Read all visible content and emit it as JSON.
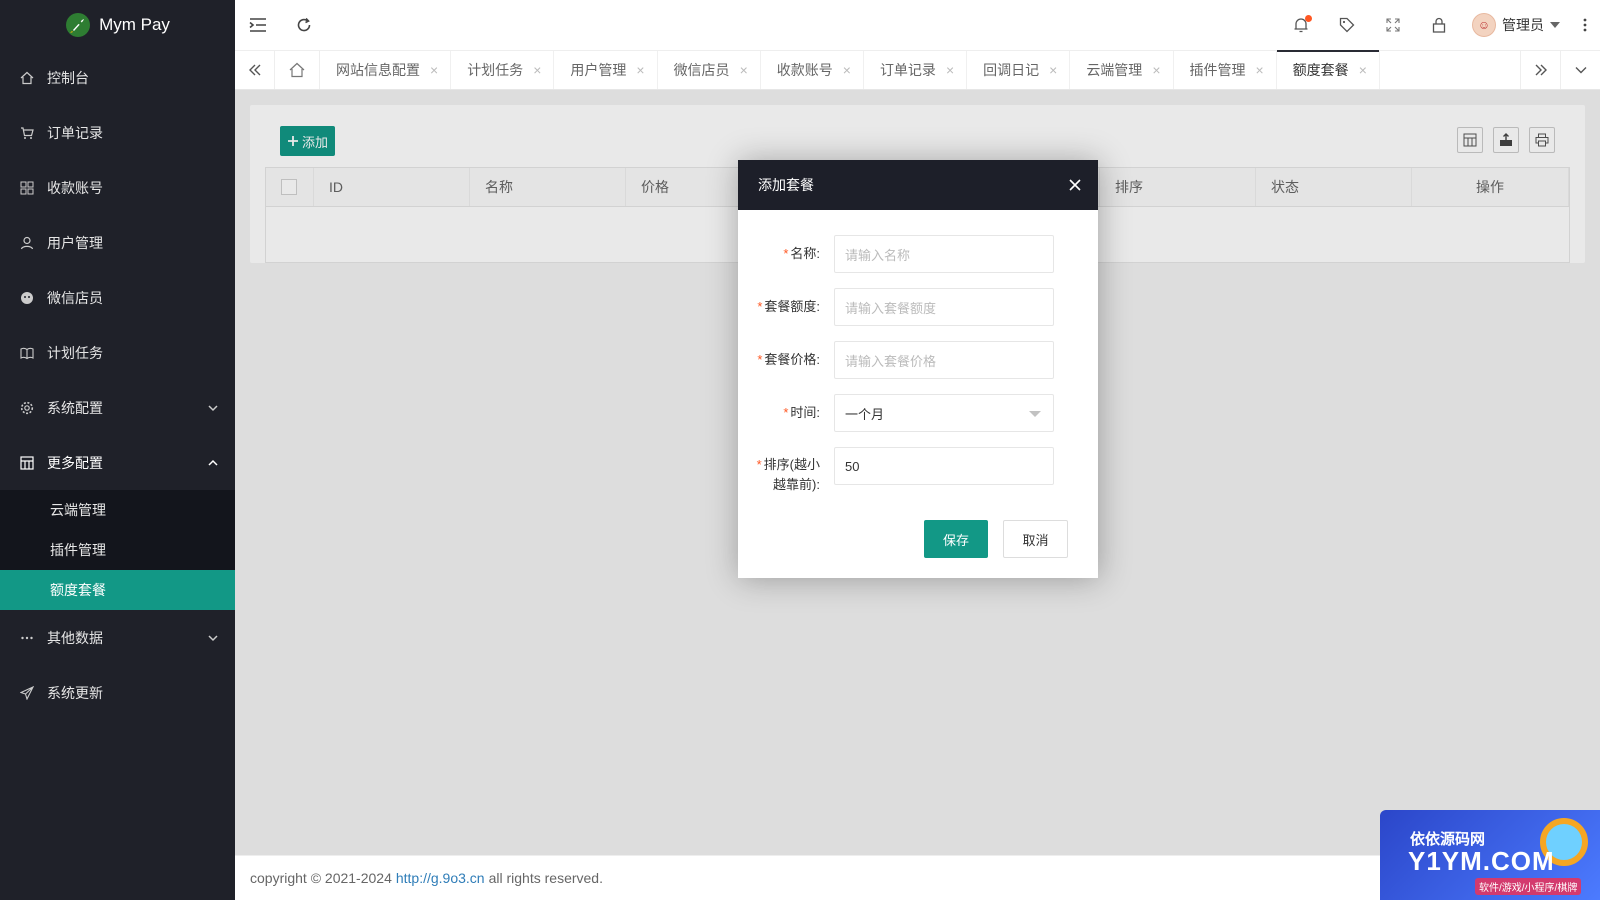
{
  "app": {
    "name": "Mym Pay"
  },
  "sidebar": {
    "items": [
      {
        "label": "控制台",
        "icon": "home-icon"
      },
      {
        "label": "订单记录",
        "icon": "cart-icon"
      },
      {
        "label": "收款账号",
        "icon": "apps-icon"
      },
      {
        "label": "用户管理",
        "icon": "user-icon"
      },
      {
        "label": "微信店员",
        "icon": "wechat-icon"
      },
      {
        "label": "计划任务",
        "icon": "book-icon"
      },
      {
        "label": "系统配置",
        "icon": "gear-icon"
      },
      {
        "label": "更多配置",
        "icon": "grid-icon"
      },
      {
        "label": "其他数据",
        "icon": "more-icon"
      },
      {
        "label": "系统更新",
        "icon": "send-icon"
      }
    ],
    "subitems": [
      {
        "label": "云端管理"
      },
      {
        "label": "插件管理"
      },
      {
        "label": "额度套餐"
      }
    ]
  },
  "header": {
    "username": "管理员"
  },
  "tabs": [
    {
      "label": "网站信息配置"
    },
    {
      "label": "计划任务"
    },
    {
      "label": "用户管理"
    },
    {
      "label": "微信店员"
    },
    {
      "label": "收款账号"
    },
    {
      "label": "订单记录"
    },
    {
      "label": "回调日记"
    },
    {
      "label": "云端管理"
    },
    {
      "label": "插件管理"
    },
    {
      "label": "额度套餐"
    }
  ],
  "toolbar": {
    "add_label": "添加"
  },
  "table": {
    "columns": [
      "ID",
      "名称",
      "价格",
      "排序",
      "状态",
      "操作"
    ]
  },
  "modal": {
    "title": "添加套餐",
    "fields": [
      {
        "label": "名称:",
        "placeholder": "请输入名称"
      },
      {
        "label": "套餐额度:",
        "placeholder": "请输入套餐额度"
      },
      {
        "label": "套餐价格:",
        "placeholder": "请输入套餐价格"
      },
      {
        "label": "时间:",
        "value": "一个月"
      },
      {
        "label_line1": "排序(越小",
        "label_line2": "越靠前):",
        "value": "50"
      }
    ],
    "required_mark": "*",
    "save_label": "保存",
    "cancel_label": "取消"
  },
  "footer": {
    "prefix": "copyright © 2021-2024",
    "link": "http://g.9o3.cn",
    "suffix": "all rights reserved."
  },
  "watermark": {
    "top": "依依源码网",
    "main": "Y1YM.COM",
    "sub": "软件/游戏/小程序/棋牌"
  },
  "colors": {
    "sidebar_bg": "#1f2129",
    "accent": "#129886",
    "modal_header": "#1d1f29",
    "notify_dot": "#ff5722"
  }
}
